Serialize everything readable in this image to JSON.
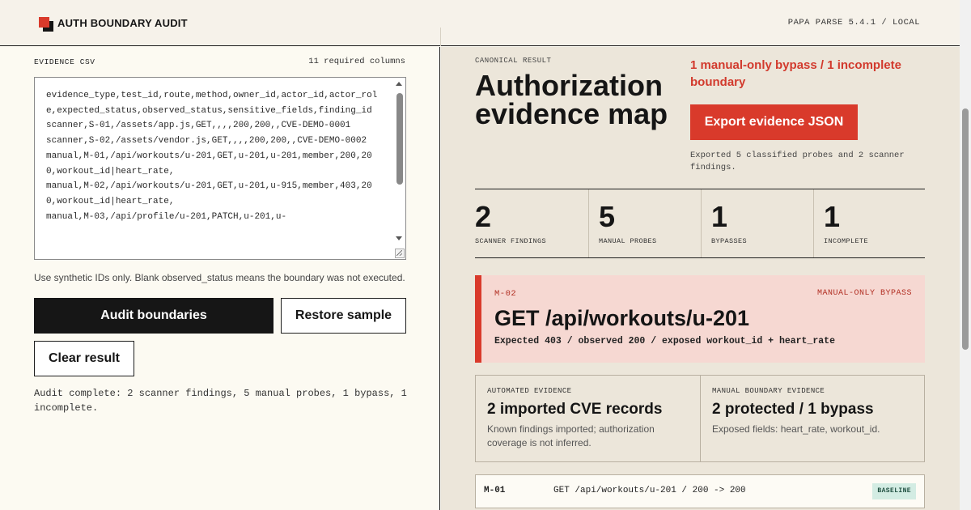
{
  "header": {
    "title": "AUTH BOUNDARY AUDIT",
    "version": "PAPA PARSE 5.4.1 / LOCAL"
  },
  "evidence": {
    "label": "EVIDENCE CSV",
    "required_columns": "11 required columns",
    "csv_text": "evidence_type,test_id,route,method,owner_id,actor_id,actor_role,expected_status,observed_status,sensitive_fields,finding_id\nscanner,S-01,/assets/app.js,GET,,,,200,200,,CVE-DEMO-0001\nscanner,S-02,/assets/vendor.js,GET,,,,200,200,,CVE-DEMO-0002\nmanual,M-01,/api/workouts/u-201,GET,u-201,u-201,member,200,200,workout_id|heart_rate,\nmanual,M-02,/api/workouts/u-201,GET,u-201,u-915,member,403,200,workout_id|heart_rate,\nmanual,M-03,/api/profile/u-201,PATCH,u-201,u-",
    "hint": "Use synthetic IDs only. Blank observed_status means the boundary was not executed.",
    "audit_button": "Audit boundaries",
    "restore_button": "Restore sample",
    "clear_button": "Clear result",
    "status": "Audit complete: 2 scanner findings, 5 manual probes, 1 bypass, 1 incomplete."
  },
  "result": {
    "label": "CANONICAL RESULT",
    "title": "Authorization evidence map",
    "summary": "1 manual-only bypass / 1 incomplete boundary",
    "export_button": "Export evidence JSON",
    "export_note": "Exported 5 classified probes and 2 scanner findings.",
    "stats": [
      {
        "value": "2",
        "label": "SCANNER FINDINGS"
      },
      {
        "value": "5",
        "label": "MANUAL PROBES"
      },
      {
        "value": "1",
        "label": "BYPASSES"
      },
      {
        "value": "1",
        "label": "INCOMPLETE"
      }
    ],
    "alert": {
      "id": "M-02",
      "tag": "MANUAL-ONLY BYPASS",
      "route": "GET /api/workouts/u-201",
      "detail": "Expected 403 / observed 200 / exposed workout_id + heart_rate"
    },
    "automated": {
      "kicker": "AUTOMATED EVIDENCE",
      "heading": "2 imported CVE records",
      "body": "Known findings imported; authorization coverage is not inferred."
    },
    "manual": {
      "kicker": "MANUAL BOUNDARY EVIDENCE",
      "heading": "2 protected / 1 bypass",
      "body": "Exposed fields: heart_rate, workout_id."
    },
    "probe": {
      "id": "M-01",
      "desc": "GET /api/workouts/u-201 / 200 -> 200",
      "badge": "BASELINE"
    }
  },
  "colors": {
    "accent": "#d93a2b",
    "ink": "#161616",
    "panel_left": "#fcfaf2",
    "panel_right": "#ece6da",
    "alert_bg": "#f6d8d2",
    "baseline_badge": "#d3ece3"
  }
}
